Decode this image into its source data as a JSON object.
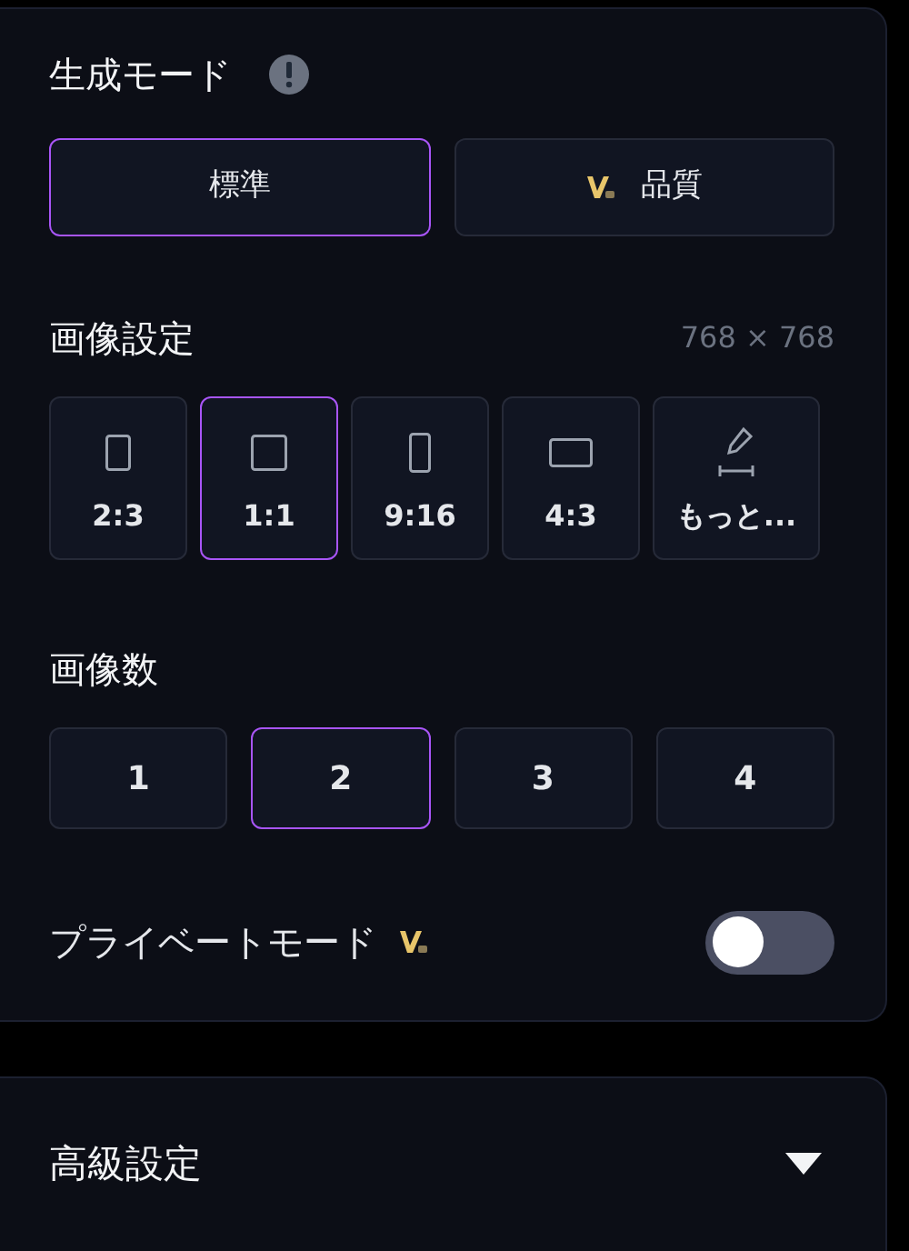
{
  "generation_mode": {
    "title": "生成モード",
    "options": [
      {
        "label": "標準",
        "selected": true,
        "premium": false
      },
      {
        "label": "品質",
        "selected": false,
        "premium": true
      }
    ]
  },
  "image_settings": {
    "title": "画像設定",
    "size": "768 × 768",
    "ratios": [
      {
        "label": "2:3",
        "kind": "portrait",
        "selected": false
      },
      {
        "label": "1:1",
        "kind": "square",
        "selected": true
      },
      {
        "label": "9:16",
        "kind": "tall",
        "selected": false
      },
      {
        "label": "4:3",
        "kind": "landscape",
        "selected": false
      },
      {
        "label": "もっと...",
        "kind": "custom",
        "selected": false
      }
    ]
  },
  "image_count": {
    "title": "画像数",
    "options": [
      {
        "label": "1",
        "selected": false
      },
      {
        "label": "2",
        "selected": true
      },
      {
        "label": "3",
        "selected": false
      },
      {
        "label": "4",
        "selected": false
      }
    ]
  },
  "private_mode": {
    "label": "プライベートモード",
    "premium": true,
    "on": false
  },
  "advanced": {
    "title": "高級設定",
    "expanded": false
  }
}
